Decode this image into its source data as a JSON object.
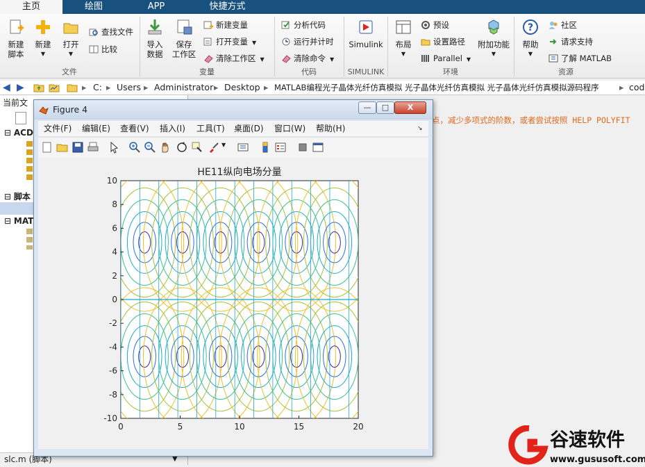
{
  "tabs": [
    "主页",
    "绘图",
    "APP",
    "快捷方式"
  ],
  "ribbon": {
    "file": {
      "new_script": "新建\n脚本",
      "new": "新建",
      "open": "打开",
      "find_files": "查找文件",
      "compare": "比较",
      "group": "文件"
    },
    "variable": {
      "import_data": "导入\n数据",
      "save_workspace": "保存\n工作区",
      "new_variable": "新建变量",
      "open_variable": "打开变量",
      "clear_workspace": "清除工作区",
      "group": "变量"
    },
    "code": {
      "analyze": "分析代码",
      "run_time": "运行并计时",
      "clear_commands": "清除命令",
      "group": "代码"
    },
    "simulink": {
      "label": "Simulink",
      "group": "SIMULINK"
    },
    "environment": {
      "layout": "布局",
      "preferences": "预设",
      "set_path": "设置路径",
      "parallel": "Parallel",
      "addons": "附加功能",
      "group": "环境"
    },
    "resources": {
      "help": "帮助",
      "community": "社区",
      "support": "请求支持",
      "learn": "了解 MATLAB",
      "group": "资源"
    }
  },
  "path": [
    "C:",
    "Users",
    "Administrator",
    "Desktop",
    "MATLAB编程光子晶体光纤仿真模拟 光子晶体光纤仿真模拟 光子晶体光纤仿真模拟源码程序",
    "cod"
  ],
  "left_panel": {
    "title": "当前文",
    "items": [
      "ACD",
      "脚本",
      "MAT"
    ],
    "status": "slc.m  (脚本)"
  },
  "command_text": "点，减少多项式的阶数，或者尝试按照 HELP POLYFIT",
  "figure": {
    "title": "Figure 4",
    "menu": [
      "文件(F)",
      "编辑(E)",
      "查看(V)",
      "插入(I)",
      "工具(T)",
      "桌面(D)",
      "窗口(W)",
      "帮助(H)"
    ],
    "min": "—",
    "max": "□",
    "close": "X"
  },
  "chart_data": {
    "type": "contour",
    "title": "HE11纵向电场分量",
    "xlim": [
      0,
      20
    ],
    "ylim": [
      -10,
      10
    ],
    "x_ticks": [
      0,
      5,
      10,
      15,
      20
    ],
    "y_ticks": [
      10,
      8,
      6,
      4,
      2,
      0,
      -2,
      -4,
      -6,
      -8,
      -10
    ],
    "x_period": 3.2,
    "lobe_centers_y": [
      4.8,
      -4.8
    ],
    "lobe_centers_x": [
      2.0,
      5.2,
      8.4,
      11.6,
      14.8,
      18.0
    ],
    "colormap": [
      "#3d26a8",
      "#2a6ee0",
      "#19a9d6",
      "#3fc08f",
      "#a7c23a",
      "#f0be2b"
    ]
  },
  "watermark": {
    "brand": "谷速软件",
    "url": "www.gususoft.com",
    "color": "#e2231a"
  }
}
